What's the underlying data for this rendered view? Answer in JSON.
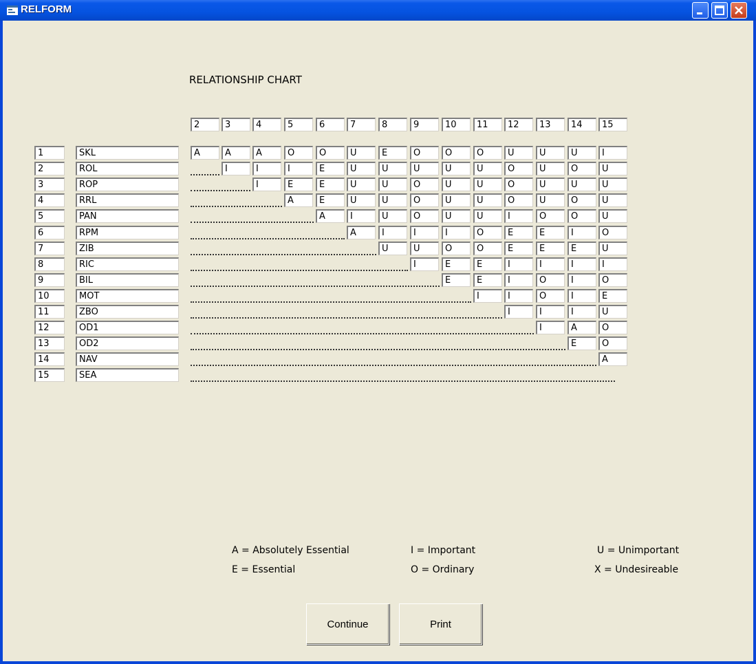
{
  "window": {
    "title": "RELFORM",
    "accent": "#0a46d8",
    "close_color": "#c63c1a"
  },
  "chart_title": "RELATIONSHIP CHART",
  "column_headers": [
    "2",
    "3",
    "4",
    "5",
    "6",
    "7",
    "8",
    "9",
    "10",
    "11",
    "12",
    "13",
    "14",
    "15"
  ],
  "rows": [
    {
      "num": "1",
      "code": "SKL",
      "values": [
        "A",
        "A",
        "A",
        "O",
        "O",
        "U",
        "E",
        "O",
        "O",
        "O",
        "U",
        "U",
        "U",
        "I"
      ]
    },
    {
      "num": "2",
      "code": "ROL",
      "values": [
        "I",
        "I",
        "I",
        "E",
        "U",
        "U",
        "U",
        "U",
        "U",
        "O",
        "U",
        "O",
        "U"
      ]
    },
    {
      "num": "3",
      "code": "ROP",
      "values": [
        "I",
        "E",
        "E",
        "U",
        "U",
        "O",
        "U",
        "U",
        "O",
        "U",
        "U",
        "U"
      ]
    },
    {
      "num": "4",
      "code": "RRL",
      "values": [
        "A",
        "E",
        "U",
        "U",
        "O",
        "U",
        "U",
        "O",
        "U",
        "O",
        "U"
      ]
    },
    {
      "num": "5",
      "code": "PAN",
      "values": [
        "A",
        "I",
        "U",
        "O",
        "U",
        "U",
        "I",
        "O",
        "O",
        "U"
      ]
    },
    {
      "num": "6",
      "code": "RPM",
      "values": [
        "A",
        "I",
        "I",
        "I",
        "O",
        "E",
        "E",
        "I",
        "O"
      ]
    },
    {
      "num": "7",
      "code": "ZIB",
      "values": [
        "U",
        "U",
        "O",
        "O",
        "E",
        "E",
        "E",
        "U"
      ]
    },
    {
      "num": "8",
      "code": "RIC",
      "values": [
        "I",
        "E",
        "E",
        "I",
        "I",
        "I",
        "I"
      ]
    },
    {
      "num": "9",
      "code": "BIL",
      "values": [
        "E",
        "E",
        "I",
        "O",
        "I",
        "O"
      ]
    },
    {
      "num": "10",
      "code": "MOT",
      "values": [
        "I",
        "I",
        "O",
        "I",
        "E"
      ]
    },
    {
      "num": "11",
      "code": "ZBO",
      "values": [
        "I",
        "I",
        "I",
        "U"
      ]
    },
    {
      "num": "12",
      "code": "OD1",
      "values": [
        "I",
        "A",
        "O"
      ]
    },
    {
      "num": "13",
      "code": "OD2",
      "values": [
        "E",
        "O"
      ]
    },
    {
      "num": "14",
      "code": "NAV",
      "values": [
        "A"
      ]
    },
    {
      "num": "15",
      "code": "SEA",
      "values": []
    }
  ],
  "legend": {
    "a": "A = Absolutely Essential",
    "e": "E = Essential",
    "i": "I =  Important",
    "o": "O = Ordinary",
    "u": "U = Unimportant",
    "x": "X = Undesireable"
  },
  "buttons": {
    "continue": "Continue",
    "print": "Print"
  }
}
